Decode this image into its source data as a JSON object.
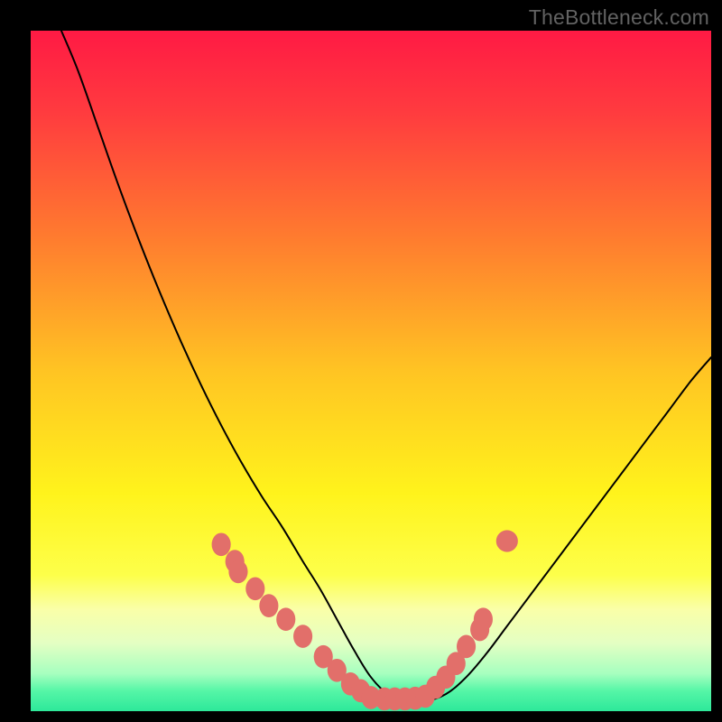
{
  "watermark": "TheBottleneck.com",
  "chart_data": {
    "type": "line",
    "title": "",
    "xlabel": "",
    "ylabel": "",
    "xlim": [
      0,
      100
    ],
    "ylim": [
      0,
      100
    ],
    "legend": false,
    "grid": false,
    "background_gradient_stops": [
      {
        "offset": 0.0,
        "color": "#ff1a44"
      },
      {
        "offset": 0.12,
        "color": "#ff3b3f"
      },
      {
        "offset": 0.3,
        "color": "#ff7a2f"
      },
      {
        "offset": 0.5,
        "color": "#ffc423"
      },
      {
        "offset": 0.68,
        "color": "#fff31c"
      },
      {
        "offset": 0.8,
        "color": "#fdff4a"
      },
      {
        "offset": 0.85,
        "color": "#faffa8"
      },
      {
        "offset": 0.9,
        "color": "#e4ffc3"
      },
      {
        "offset": 0.945,
        "color": "#a6ffbf"
      },
      {
        "offset": 0.97,
        "color": "#56f6a7"
      },
      {
        "offset": 1.0,
        "color": "#2de89a"
      }
    ],
    "series": [
      {
        "name": "bottleneck-curve",
        "stroke": "#000000",
        "stroke_width": 2,
        "x": [
          4.5,
          7,
          10,
          13,
          16,
          19,
          22,
          25,
          28,
          31,
          34,
          37,
          40,
          42.5,
          45,
          47.5,
          50,
          52.5,
          55,
          58,
          61,
          64,
          67,
          70,
          73,
          76,
          79,
          82,
          85,
          88,
          91,
          94,
          97,
          100
        ],
        "y": [
          100,
          94,
          85.5,
          77,
          69,
          61.5,
          54.5,
          48,
          42,
          36.5,
          31.5,
          27,
          22,
          18,
          13.5,
          9,
          5,
          2.5,
          1.5,
          1.5,
          2.5,
          5,
          8.5,
          12.5,
          16.5,
          20.5,
          24.5,
          28.5,
          32.5,
          36.5,
          40.5,
          44.5,
          48.5,
          52
        ]
      }
    ],
    "points": [
      {
        "name": "sample-markers",
        "fill": "#e26f6a",
        "radius_x": 1.4,
        "radius_y": 1.7,
        "x": [
          28,
          30,
          30.5,
          33,
          35,
          37.5,
          40,
          43,
          45,
          47,
          48.5,
          50,
          52,
          53.5,
          55,
          56.5,
          58,
          59.5,
          61,
          62.5,
          64,
          66,
          66.5
        ],
        "y": [
          24.5,
          22,
          20.5,
          18,
          15.5,
          13.5,
          11,
          8,
          6,
          4,
          3,
          2,
          1.8,
          1.8,
          1.8,
          1.9,
          2.2,
          3.5,
          5,
          7,
          9.5,
          12,
          13.5
        ]
      },
      {
        "name": "stray-marker",
        "fill": "#e26f6a",
        "radius_x": 1.6,
        "radius_y": 1.6,
        "x": [
          70
        ],
        "y": [
          25
        ]
      }
    ]
  }
}
